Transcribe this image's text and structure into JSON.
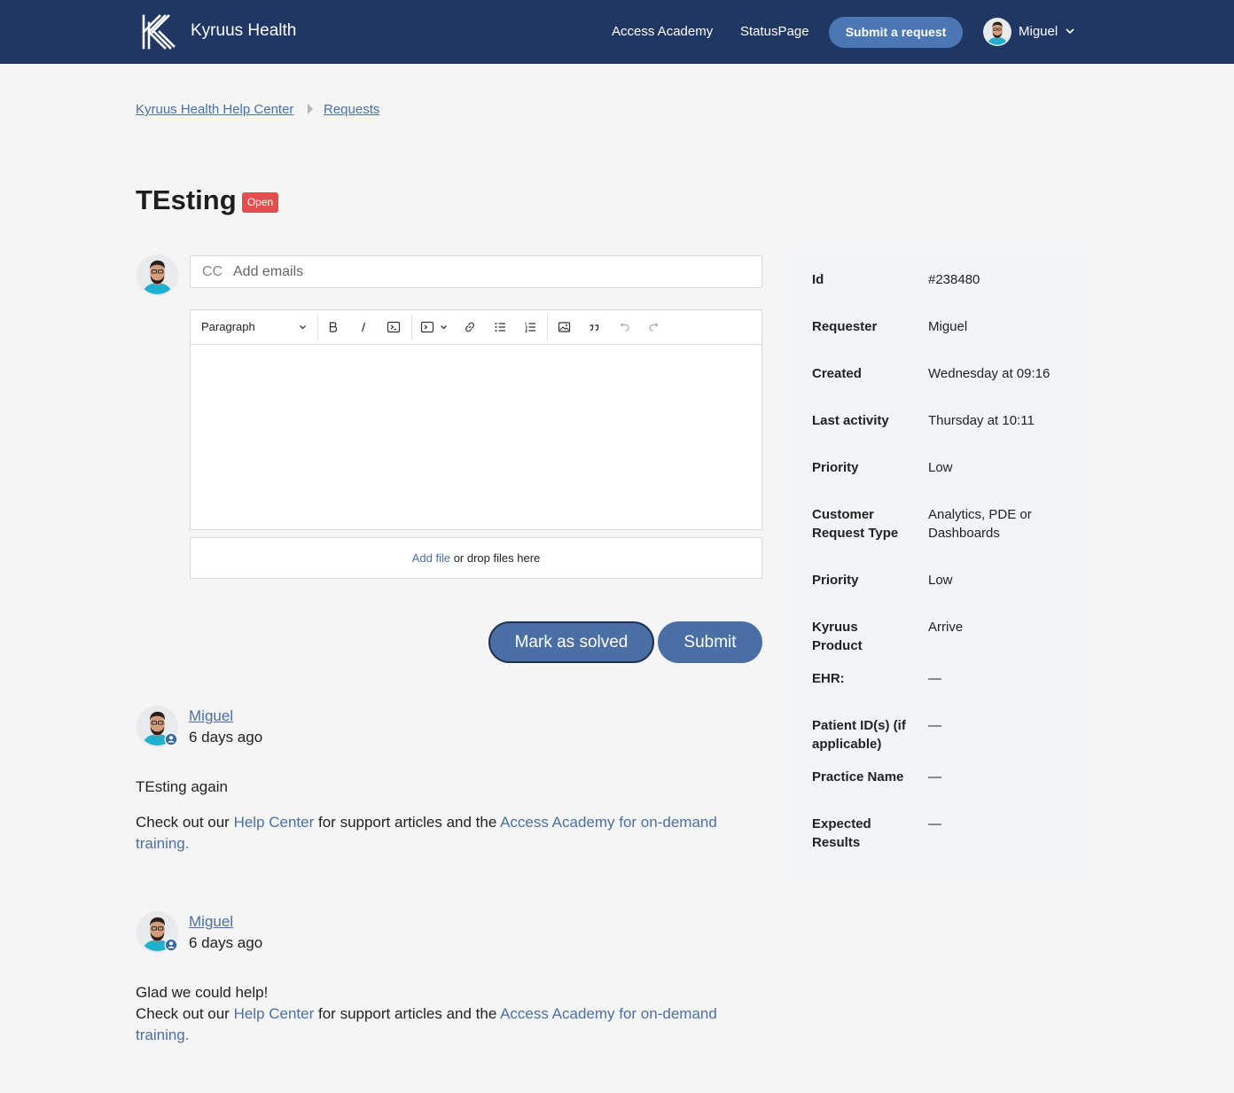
{
  "header": {
    "brand": "Kyruus Health",
    "nav": [
      "Access Academy",
      "StatusPage"
    ],
    "submit_request": "Submit a request",
    "user": "Miguel"
  },
  "breadcrumb": [
    "Kyruus Health Help Center",
    "Requests"
  ],
  "request": {
    "title": "TEsting",
    "status": "Open"
  },
  "composer": {
    "cc_label": "CC",
    "cc_placeholder": "Add emails",
    "paragraph": "Paragraph",
    "add_file": "Add file",
    "drop_text": " or drop files here",
    "mark_solved": "Mark as solved",
    "submit": "Submit"
  },
  "comments": [
    {
      "author": "Miguel",
      "time": "6 days ago",
      "line1": "TEsting again",
      "check_pre": "Check out our ",
      "help_center": "Help Center",
      "check_mid": " for support articles and the ",
      "academy_link": "Access Academy for on-demand training."
    },
    {
      "author": "Miguel",
      "time": "6 days ago",
      "line1": "Glad we could help!",
      "check_pre": "Check out our ",
      "help_center": "Help Center",
      "check_mid": " for support articles and the ",
      "academy_link": "Access Academy for on-demand training."
    }
  ],
  "details": [
    {
      "key": "Id",
      "value": "#238480"
    },
    {
      "key": "Requester",
      "value": "Miguel"
    },
    {
      "key": "Created",
      "value": "Wednesday at 09:16"
    },
    {
      "key": "Last activity",
      "value": "Thursday at 10:11"
    },
    {
      "key": "Priority",
      "value": "Low"
    },
    {
      "key": "Customer Request Type",
      "value": "Analytics, PDE or Dashboards"
    },
    {
      "key": "Priority",
      "value": "Low"
    },
    {
      "key": "Kyruus Product",
      "value": "Arrive"
    },
    {
      "key": "EHR:",
      "value": "—"
    },
    {
      "key": "Patient ID(s) (if applicable)",
      "value": "—"
    },
    {
      "key": "Practice Name",
      "value": "—"
    },
    {
      "key": "Expected Results",
      "value": "—"
    }
  ],
  "colors": {
    "header_bg": "#213763",
    "accent": "#4a6fa5",
    "status_open": "#e34f4f"
  }
}
